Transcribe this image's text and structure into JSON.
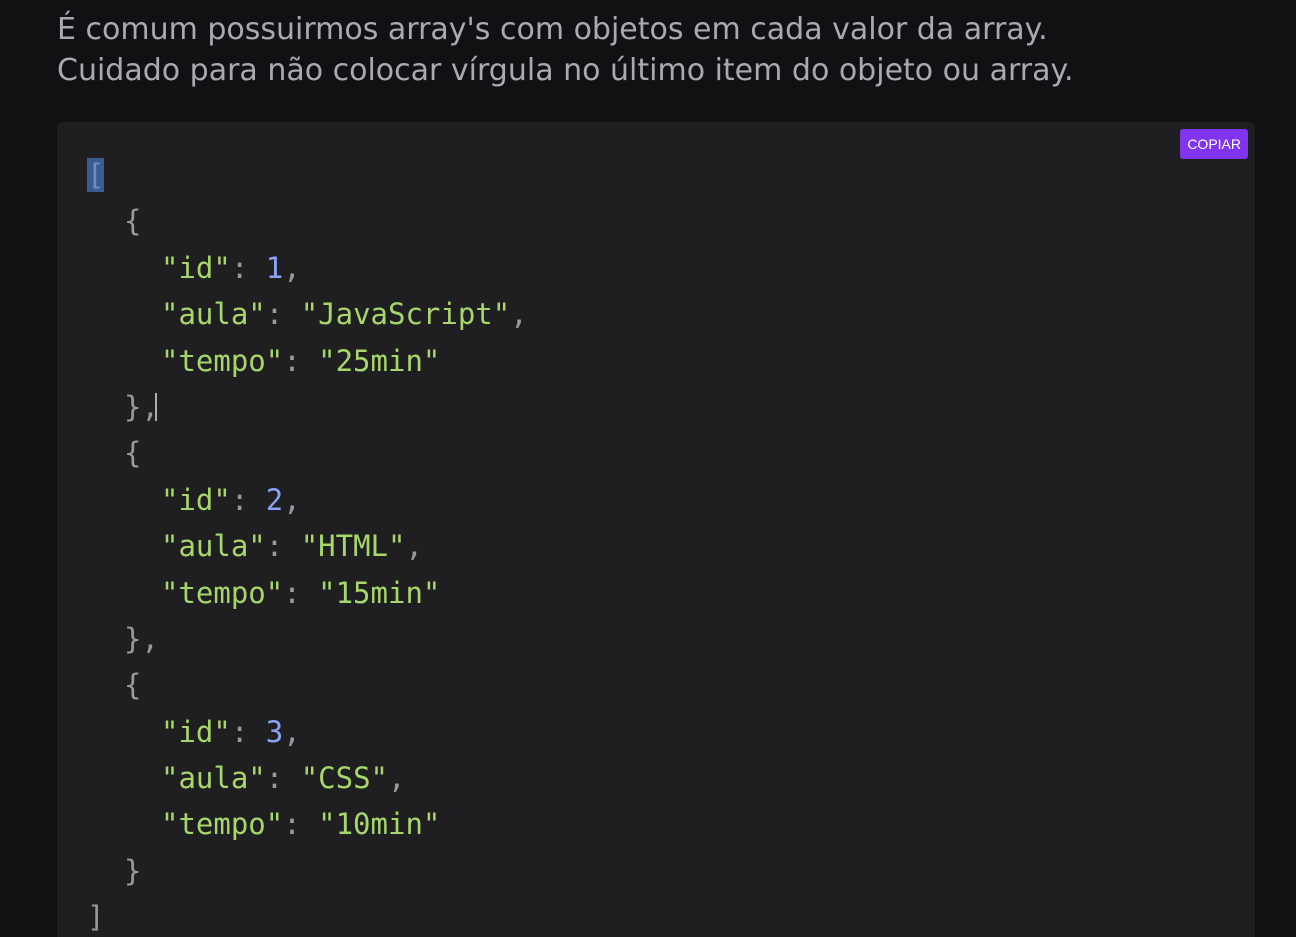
{
  "intro": {
    "line1": "É comum possuirmos array's com objetos em cada valor da array.",
    "line2": "Cuidado para não colocar vírgula no último item do objeto ou array."
  },
  "code_block": {
    "copy_label": "COPIAR",
    "open_bracket": "[",
    "close_bracket": "]",
    "items": [
      {
        "open": "{",
        "close": "},",
        "id_key": "\"id\"",
        "id_value": "1",
        "aula_key": "\"aula\"",
        "aula_value": "\"JavaScript\"",
        "tempo_key": "\"tempo\"",
        "tempo_value": "\"25min\""
      },
      {
        "open": "{",
        "close": "},",
        "id_key": "\"id\"",
        "id_value": "2",
        "aula_key": "\"aula\"",
        "aula_value": "\"HTML\"",
        "tempo_key": "\"tempo\"",
        "tempo_value": "\"15min\""
      },
      {
        "open": "{",
        "close": "}",
        "id_key": "\"id\"",
        "id_value": "3",
        "aula_key": "\"aula\"",
        "aula_value": "\"CSS\"",
        "tempo_key": "\"tempo\"",
        "tempo_value": "\"10min\""
      }
    ]
  },
  "colors": {
    "background": "#111114",
    "code_background": "#1f1f21",
    "copy_button": "#8034ee",
    "string_key": "#a7d66a",
    "number": "#8ba3f2",
    "selection": "#3b5c8e"
  }
}
